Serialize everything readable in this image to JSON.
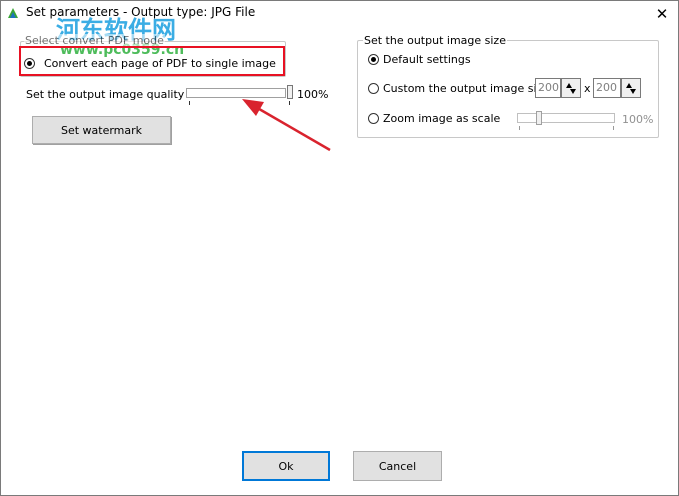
{
  "window": {
    "title": "Set parameters - Output type: JPG File",
    "close_glyph": "✕"
  },
  "watermark": {
    "line1": "河东软件网",
    "line2": "www.pc0359.cn"
  },
  "convert_mode": {
    "group_title": "Select convert PDF mode",
    "option_label": "Convert each page of PDF to single image",
    "highlight_color": "#e81123"
  },
  "quality": {
    "label": "Set the output image quality",
    "value_text": "100%",
    "value": 1.0
  },
  "watermark_button": {
    "label": "Set watermark"
  },
  "output_size": {
    "group_title": "Set the output image size",
    "options": [
      {
        "label": "Default settings",
        "selected": true
      },
      {
        "label": "Custom the output image size",
        "selected": false
      },
      {
        "label": "Zoom image as scale",
        "selected": false
      }
    ],
    "width_value": "200",
    "separator": "x",
    "height_value": "200",
    "scale_value_text": "100%"
  },
  "footer": {
    "ok_label": "Ok",
    "cancel_label": "Cancel"
  },
  "colors": {
    "arrow": "#d9232e",
    "button_face": "#e1e1e1",
    "focus_border": "#0078d7"
  }
}
